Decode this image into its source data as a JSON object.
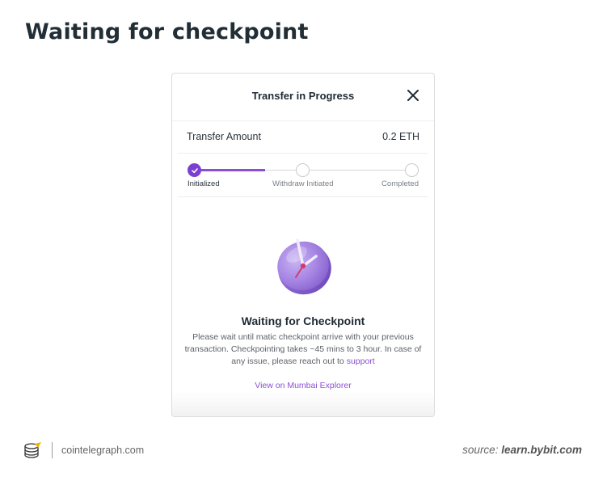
{
  "page": {
    "title": "Waiting for checkpoint"
  },
  "modal": {
    "title": "Transfer in Progress",
    "close_icon": "close-icon",
    "amount": {
      "label": "Transfer Amount",
      "value": "0.2 ETH"
    },
    "stepper": {
      "progress": 0.33,
      "steps": [
        {
          "label": "Initialized",
          "state": "done"
        },
        {
          "label": "Withdraw Initiated",
          "state": "pending"
        },
        {
          "label": "Completed",
          "state": "pending"
        }
      ]
    },
    "illustration_icon": "clock-icon",
    "status": {
      "title": "Waiting for Checkpoint",
      "description": "Please wait until matic checkpoint arrive with your previous transaction. Checkpointing takes ~45 mins to 3 hour. In case of any issue, please reach out to",
      "support_link": "support"
    },
    "explorer_link": "View on Mumbai Explorer"
  },
  "footer": {
    "brand": "cointelegraph.com",
    "source_prefix": "source:",
    "source_domain": "learn.bybit.com"
  },
  "colors": {
    "accent": "#8b4fd6",
    "title": "#222e36"
  }
}
